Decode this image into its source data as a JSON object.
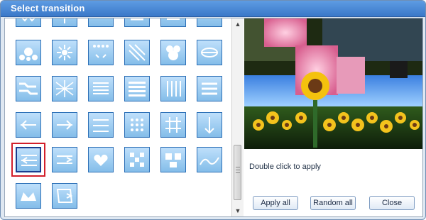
{
  "window": {
    "title": "Select transition"
  },
  "preview": {
    "hint": "Double click to apply",
    "buttons": {
      "apply_all": "Apply all",
      "random_all": "Random all",
      "close": "Close"
    }
  },
  "transitions": {
    "selected_row": 4,
    "selected_col": 0,
    "icon_names": [
      "split-transition-icon",
      "circle-transition-icon",
      "dissolve-transition-icon",
      "arrows-transition-icon",
      "grid-transition-icon"
    ]
  },
  "scrollbar": {
    "up_icon": "scroll-up-icon",
    "down_icon": "scroll-down-icon"
  }
}
